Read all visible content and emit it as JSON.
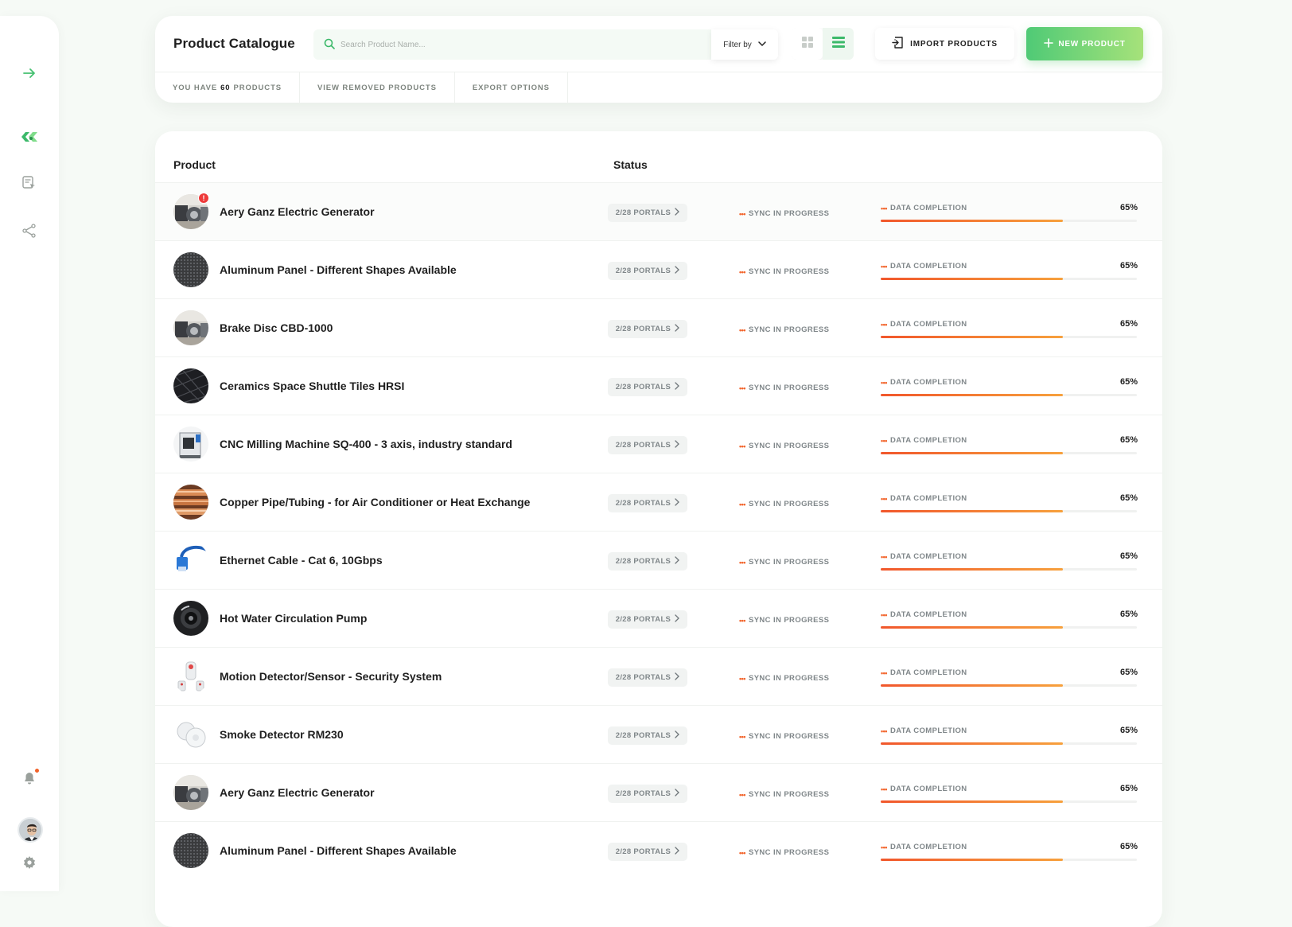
{
  "sidebar": {
    "icons": [
      {
        "name": "expand-arrow-icon"
      },
      {
        "name": "tag-discount-icon"
      },
      {
        "name": "catalogue-click-icon"
      },
      {
        "name": "share-icon"
      },
      {
        "name": "bell-icon"
      },
      {
        "name": "gear-icon"
      }
    ],
    "accent": "#4fca76"
  },
  "header": {
    "title": "Product Catalogue",
    "search_placeholder": "Search Product Name...",
    "filter_label": "Filter by",
    "import_label": "IMPORT PRODUCTS",
    "new_label": "NEW PRODUCT",
    "subnav": {
      "count_prefix": "YOU HAVE",
      "count": "60",
      "count_suffix": "PRODUCTS",
      "removed": "VIEW REMOVED PRODUCTS",
      "export": "EXPORT OPTIONS"
    }
  },
  "table": {
    "col_product": "Product",
    "col_status": "Status",
    "rows": [
      {
        "name": "Aery Ganz Electric Generator",
        "thumb": "generator",
        "alert": "!",
        "portals": "2/28 PORTALS",
        "sync": "SYNC IN PROGRESS",
        "dc_label": "DATA COMPLETION",
        "pct_text": "65%",
        "pct": 0.71
      },
      {
        "name": "Aluminum Panel - Different Shapes Available",
        "thumb": "mesh",
        "alert": "",
        "portals": "2/28 PORTALS",
        "sync": "SYNC IN PROGRESS",
        "dc_label": "DATA COMPLETION",
        "pct_text": "65%",
        "pct": 0.71
      },
      {
        "name": "Brake Disc CBD-1000",
        "thumb": "generator",
        "alert": "",
        "portals": "2/28 PORTALS",
        "sync": "SYNC IN PROGRESS",
        "dc_label": "DATA COMPLETION",
        "pct_text": "65%",
        "pct": 0.71
      },
      {
        "name": "Ceramics Space Shuttle Tiles HRSI",
        "thumb": "tiles",
        "alert": "",
        "portals": "2/28 PORTALS",
        "sync": "SYNC IN PROGRESS",
        "dc_label": "DATA COMPLETION",
        "pct_text": "65%",
        "pct": 0.71
      },
      {
        "name": "CNC Milling Machine SQ-400 - 3 axis, industry standard",
        "thumb": "cnc",
        "alert": "",
        "portals": "2/28 PORTALS",
        "sync": "SYNC IN PROGRESS",
        "dc_label": "DATA COMPLETION",
        "pct_text": "65%",
        "pct": 0.71
      },
      {
        "name": "Copper Pipe/Tubing - for Air Conditioner or Heat Exchange",
        "thumb": "copper",
        "alert": "",
        "portals": "2/28 PORTALS",
        "sync": "SYNC IN PROGRESS",
        "dc_label": "DATA COMPLETION",
        "pct_text": "65%",
        "pct": 0.71
      },
      {
        "name": "Ethernet Cable - Cat 6, 10Gbps",
        "thumb": "cable",
        "alert": "",
        "portals": "2/28 PORTALS",
        "sync": "SYNC IN PROGRESS",
        "dc_label": "DATA COMPLETION",
        "pct_text": "65%",
        "pct": 0.71
      },
      {
        "name": "Hot Water Circulation Pump",
        "thumb": "pump",
        "alert": "",
        "portals": "2/28 PORTALS",
        "sync": "SYNC IN PROGRESS",
        "dc_label": "DATA COMPLETION",
        "pct_text": "65%",
        "pct": 0.71
      },
      {
        "name": "Motion Detector/Sensor - Security System",
        "thumb": "sensor",
        "alert": "",
        "portals": "2/28 PORTALS",
        "sync": "SYNC IN PROGRESS",
        "dc_label": "DATA COMPLETION",
        "pct_text": "65%",
        "pct": 0.71
      },
      {
        "name": "Smoke Detector RM230",
        "thumb": "smoke",
        "alert": "",
        "portals": "2/28 PORTALS",
        "sync": "SYNC IN PROGRESS",
        "dc_label": "DATA COMPLETION",
        "pct_text": "65%",
        "pct": 0.71
      },
      {
        "name": "Aery Ganz Electric Generator",
        "thumb": "generator",
        "alert": "",
        "portals": "2/28 PORTALS",
        "sync": "SYNC IN PROGRESS",
        "dc_label": "DATA COMPLETION",
        "pct_text": "65%",
        "pct": 0.71
      },
      {
        "name": "Aluminum Panel - Different Shapes Available",
        "thumb": "mesh",
        "alert": "",
        "portals": "2/28 PORTALS",
        "sync": "SYNC IN PROGRESS",
        "dc_label": "DATA COMPLETION",
        "pct_text": "65%",
        "pct": 0.71
      }
    ]
  },
  "colors": {
    "progress_start": "#f1572c",
    "progress_end": "#f7a13d",
    "accent_green": "#4fca76",
    "alert_red": "#ee3a3a"
  }
}
